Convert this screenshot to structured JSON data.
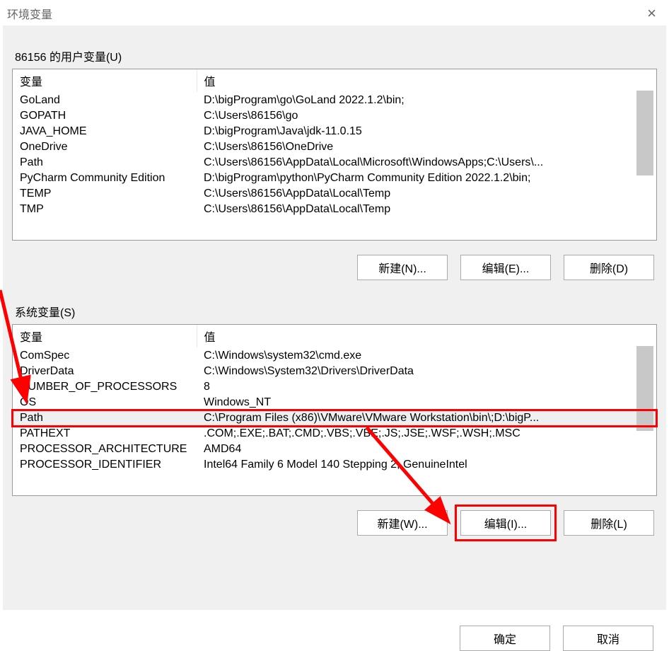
{
  "dialog": {
    "title": "环境变量",
    "ok": "确定",
    "cancel": "取消"
  },
  "user_vars": {
    "label": "86156 的用户变量(U)",
    "col_variable": "变量",
    "col_value": "值",
    "rows": [
      {
        "name": "GoLand",
        "value": "D:\\bigProgram\\go\\GoLand 2022.1.2\\bin;"
      },
      {
        "name": "GOPATH",
        "value": "C:\\Users\\86156\\go"
      },
      {
        "name": "JAVA_HOME",
        "value": "D:\\bigProgram\\Java\\jdk-11.0.15"
      },
      {
        "name": "OneDrive",
        "value": "C:\\Users\\86156\\OneDrive"
      },
      {
        "name": "Path",
        "value": "C:\\Users\\86156\\AppData\\Local\\Microsoft\\WindowsApps;C:\\Users\\..."
      },
      {
        "name": "PyCharm Community Edition",
        "value": "D:\\bigProgram\\python\\PyCharm Community Edition 2022.1.2\\bin;"
      },
      {
        "name": "TEMP",
        "value": "C:\\Users\\86156\\AppData\\Local\\Temp"
      },
      {
        "name": "TMP",
        "value": "C:\\Users\\86156\\AppData\\Local\\Temp"
      }
    ],
    "new": "新建(N)...",
    "edit": "编辑(E)...",
    "delete": "删除(D)"
  },
  "sys_vars": {
    "label": "系统变量(S)",
    "col_variable": "变量",
    "col_value": "值",
    "rows": [
      {
        "name": "ComSpec",
        "value": "C:\\Windows\\system32\\cmd.exe"
      },
      {
        "name": "DriverData",
        "value": "C:\\Windows\\System32\\Drivers\\DriverData"
      },
      {
        "name": "NUMBER_OF_PROCESSORS",
        "value": "8"
      },
      {
        "name": "OS",
        "value": "Windows_NT"
      },
      {
        "name": "Path",
        "value": "C:\\Program Files (x86)\\VMware\\VMware Workstation\\bin\\;D:\\bigP..."
      },
      {
        "name": "PATHEXT",
        "value": ".COM;.EXE;.BAT;.CMD;.VBS;.VBE;.JS;.JSE;.WSF;.WSH;.MSC"
      },
      {
        "name": "PROCESSOR_ARCHITECTURE",
        "value": "AMD64"
      },
      {
        "name": "PROCESSOR_IDENTIFIER",
        "value": "Intel64 Family 6 Model 140 Stepping 2, GenuineIntel"
      }
    ],
    "selected_index": 4,
    "new": "新建(W)...",
    "edit": "编辑(I)...",
    "delete": "删除(L)"
  }
}
